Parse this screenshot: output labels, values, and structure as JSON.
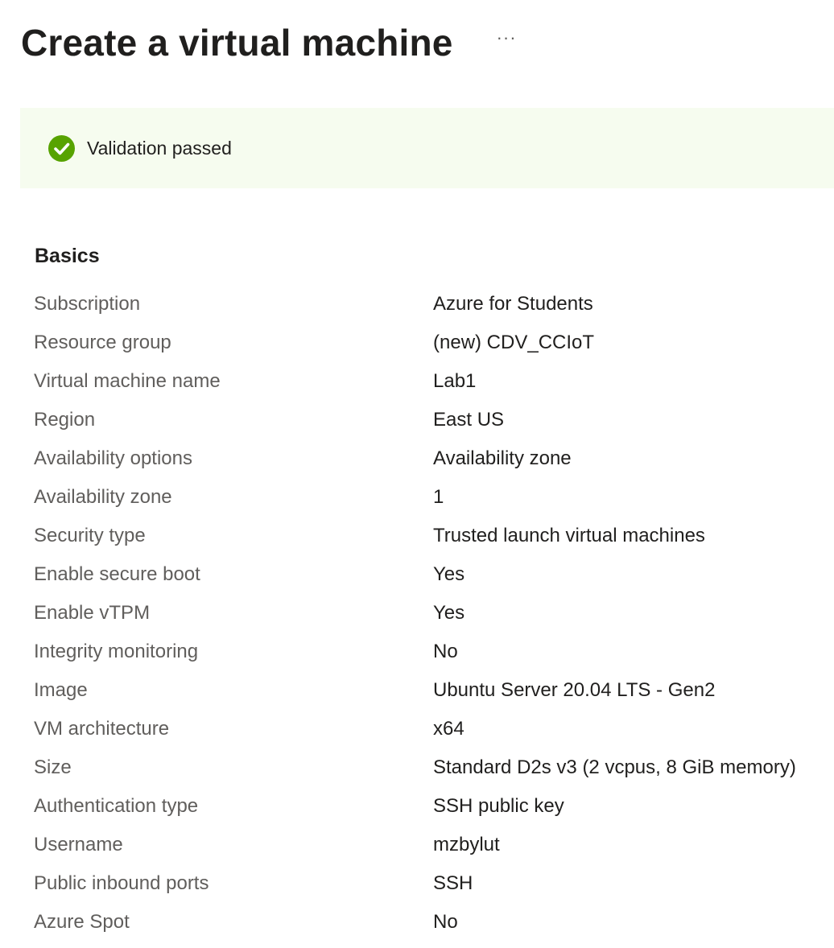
{
  "header": {
    "title": "Create a virtual machine",
    "more_label": "···"
  },
  "banner": {
    "icon": "check-circle-icon",
    "text": "Validation passed",
    "color": "#57a300",
    "background": "#f6fcef"
  },
  "section": {
    "heading": "Basics",
    "rows": [
      {
        "label": "Subscription",
        "value": "Azure for Students"
      },
      {
        "label": "Resource group",
        "value": "(new) CDV_CCIoT"
      },
      {
        "label": "Virtual machine name",
        "value": "Lab1"
      },
      {
        "label": "Region",
        "value": "East US"
      },
      {
        "label": "Availability options",
        "value": "Availability zone"
      },
      {
        "label": "Availability zone",
        "value": "1"
      },
      {
        "label": "Security type",
        "value": "Trusted launch virtual machines"
      },
      {
        "label": "Enable secure boot",
        "value": "Yes"
      },
      {
        "label": "Enable vTPM",
        "value": "Yes"
      },
      {
        "label": "Integrity monitoring",
        "value": "No"
      },
      {
        "label": "Image",
        "value": "Ubuntu Server 20.04 LTS - Gen2"
      },
      {
        "label": "VM architecture",
        "value": "x64"
      },
      {
        "label": "Size",
        "value": "Standard D2s v3 (2 vcpus, 8 GiB memory)"
      },
      {
        "label": "Authentication type",
        "value": "SSH public key"
      },
      {
        "label": "Username",
        "value": "mzbylut"
      },
      {
        "label": "Public inbound ports",
        "value": "SSH"
      },
      {
        "label": "Azure Spot",
        "value": "No"
      }
    ]
  }
}
